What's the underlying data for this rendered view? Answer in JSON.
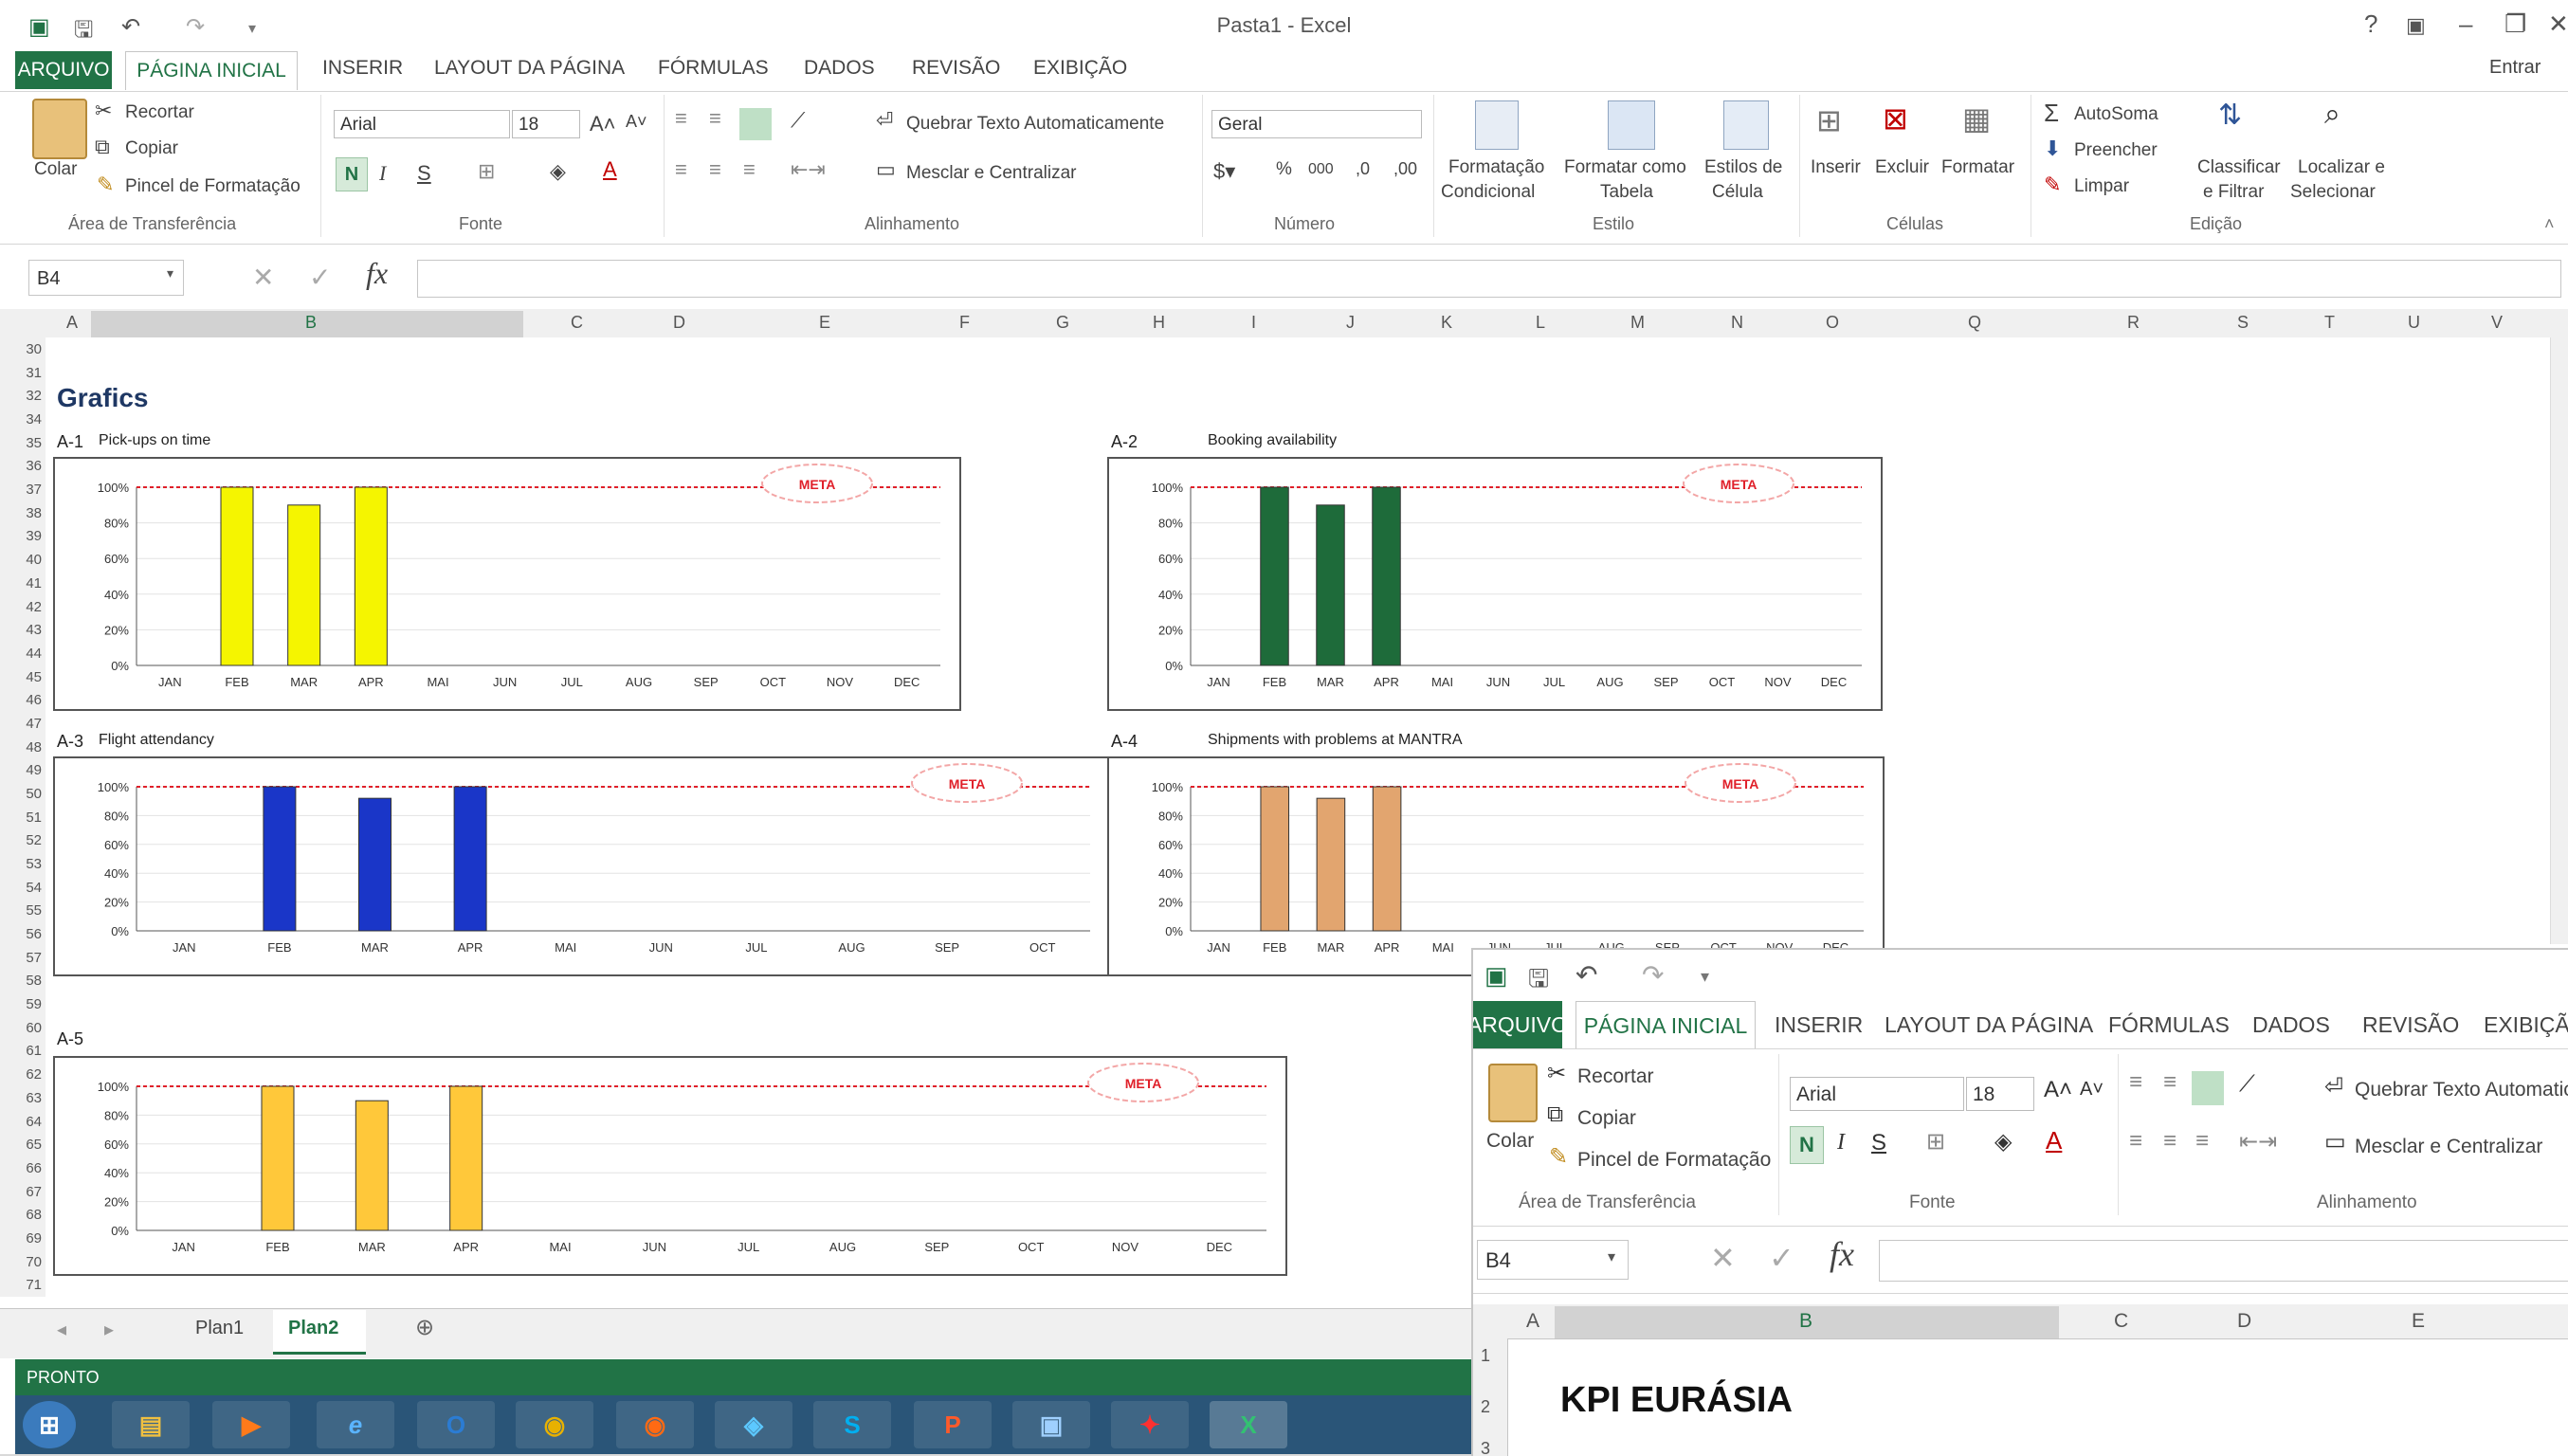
{
  "window": {
    "title": "Pasta1 - Excel",
    "qat_icons": [
      "excel-logo-icon",
      "save-icon",
      "undo-icon",
      "redo-icon",
      "customize-icon"
    ],
    "controls": [
      "?",
      "▣",
      "–",
      "❐",
      "✕"
    ],
    "sign_in": "Entrar"
  },
  "tabs": [
    "ARQUIVO",
    "PÁGINA INICIAL",
    "INSERIR",
    "LAYOUT DA PÁGINA",
    "FÓRMULAS",
    "DADOS",
    "REVISÃO",
    "EXIBIÇÃO"
  ],
  "ribbon": {
    "clipboard": {
      "paste": "Colar",
      "cut": "Recortar",
      "copy": "Copiar",
      "format_painter": "Pincel de Formatação",
      "group": "Área de Transferência"
    },
    "font": {
      "name": "Arial",
      "size": "18",
      "bold": "N",
      "italic": "I",
      "underline": "S",
      "group": "Fonte"
    },
    "alignment": {
      "wrap": "Quebrar Texto Automaticamente",
      "merge": "Mesclar e Centralizar",
      "group": "Alinhamento"
    },
    "number": {
      "format": "Geral",
      "group": "Número"
    },
    "styles": {
      "conditional": "Formatação",
      "conditional2": "Condicional",
      "table": "Formatar como",
      "table2": "Tabela",
      "cell": "Estilos de",
      "cell2": "Célula",
      "group": "Estilo"
    },
    "cells": {
      "insert": "Inserir",
      "delete": "Excluir",
      "format": "Formatar",
      "group": "Células"
    },
    "editing": {
      "autosum": "AutoSoma",
      "fill": "Preencher",
      "clear": "Limpar",
      "sort": "Classificar",
      "sort2": "e Filtrar",
      "find": "Localizar e",
      "find2": "Selecionar",
      "group": "Edição"
    }
  },
  "formula_bar": {
    "name_box": "B4",
    "fx": "fx",
    "content": ""
  },
  "columns": [
    "A",
    "B",
    "C",
    "D",
    "E",
    "F",
    "G",
    "H",
    "I",
    "J",
    "K",
    "L",
    "M",
    "N",
    "O",
    "Q",
    "R",
    "S",
    "T",
    "U",
    "V"
  ],
  "rows": [
    "30",
    "31",
    "32",
    "34",
    "35",
    "36",
    "37",
    "38",
    "39",
    "40",
    "41",
    "42",
    "43",
    "44",
    "45",
    "46",
    "47",
    "48",
    "49",
    "50",
    "51",
    "52",
    "53",
    "54",
    "55",
    "56",
    "57",
    "58",
    "59",
    "60",
    "61",
    "62",
    "63",
    "64",
    "65",
    "66",
    "67",
    "68",
    "69",
    "70",
    "71"
  ],
  "sheet_heading": "Grafics",
  "meta_label": "META",
  "chart_data": [
    {
      "id": "A-1",
      "title": "Pick-ups on time",
      "type": "bar",
      "color": "#f5f500",
      "categories": [
        "JAN",
        "FEB",
        "MAR",
        "APR",
        "MAI",
        "JUN",
        "JUL",
        "AUG",
        "SEP",
        "OCT",
        "NOV",
        "DEC"
      ],
      "values": [
        0,
        100,
        90,
        100,
        0,
        0,
        0,
        0,
        0,
        0,
        0,
        0
      ],
      "yticks": [
        "100%",
        "80%",
        "60%",
        "40%",
        "20%",
        "0%"
      ],
      "ylim": [
        0,
        100
      ],
      "target": 100
    },
    {
      "id": "A-2",
      "title": "Booking availability",
      "type": "bar",
      "color": "#1e6b3a",
      "categories": [
        "JAN",
        "FEB",
        "MAR",
        "APR",
        "MAI",
        "JUN",
        "JUL",
        "AUG",
        "SEP",
        "OCT",
        "NOV",
        "DEC"
      ],
      "values": [
        0,
        100,
        90,
        100,
        0,
        0,
        0,
        0,
        0,
        0,
        0,
        0
      ],
      "yticks": [
        "100%",
        "80%",
        "60%",
        "40%",
        "20%",
        "0%"
      ],
      "ylim": [
        0,
        100
      ],
      "target": 100
    },
    {
      "id": "A-3",
      "title": "Flight attendancy",
      "type": "bar",
      "color": "#1a36c8",
      "categories": [
        "JAN",
        "FEB",
        "MAR",
        "APR",
        "MAI",
        "JUN",
        "JUL",
        "AUG",
        "SEP",
        "OCT"
      ],
      "values": [
        0,
        100,
        92,
        100,
        0,
        0,
        0,
        0,
        0,
        0
      ],
      "yticks": [
        "100%",
        "80%",
        "60%",
        "40%",
        "20%",
        "0%"
      ],
      "ylim": [
        0,
        100
      ],
      "target": 100
    },
    {
      "id": "A-4",
      "title": "Shipments with problems at MANTRA",
      "type": "bar",
      "color": "#e2a56f",
      "categories": [
        "JAN",
        "FEB",
        "MAR",
        "APR",
        "MAI",
        "JUN",
        "JUL",
        "AUG",
        "SEP",
        "OCT",
        "NOV",
        "DEC"
      ],
      "values": [
        0,
        100,
        92,
        100,
        0,
        0,
        0,
        0,
        0,
        0,
        0,
        0
      ],
      "yticks": [
        "100%",
        "80%",
        "60%",
        "40%",
        "20%",
        "0%"
      ],
      "ylim": [
        0,
        100
      ],
      "target": 100
    },
    {
      "id": "A-5",
      "title": "",
      "type": "bar",
      "color": "#ffc83a",
      "categories": [
        "JAN",
        "FEB",
        "MAR",
        "APR",
        "MAI",
        "JUN",
        "JUL",
        "AUG",
        "SEP",
        "OCT",
        "NOV",
        "DEC"
      ],
      "values": [
        0,
        100,
        90,
        100,
        0,
        0,
        0,
        0,
        0,
        0,
        0,
        0
      ],
      "yticks": [
        "100%",
        "80%",
        "60%",
        "40%",
        "20%",
        "0%"
      ],
      "ylim": [
        0,
        100
      ],
      "target": 100
    }
  ],
  "sheet_tabs": [
    "Plan1",
    "Plan2"
  ],
  "status": "PRONTO",
  "taskbar": [
    "start-icon",
    "explorer-icon",
    "media-player-icon",
    "internet-explorer-icon",
    "outlook-icon",
    "chrome-icon",
    "firefox-icon",
    "lync-icon",
    "skype-icon",
    "powerpoint-icon",
    "network-icon",
    "acrobat-icon",
    "excel-icon"
  ],
  "taskbar_glyphs": [
    "⊞",
    "▤",
    "▶",
    "e",
    "O",
    "◉",
    "◉",
    "◈",
    "S",
    "P",
    "▣",
    "✦",
    "X"
  ],
  "window2": {
    "tabs": [
      "ARQUIVO",
      "PÁGINA INICIAL",
      "INSERIR",
      "LAYOUT DA PÁGINA",
      "FÓRMULAS",
      "DADOS",
      "REVISÃO",
      "EXIBIÇÃO"
    ],
    "cut": "Recortar",
    "copy": "Copiar",
    "format_painter": "Pincel de Formatação",
    "paste": "Colar",
    "clipboard_group": "Área de Transferência",
    "font_name": "Arial",
    "font_size": "18",
    "font_group": "Fonte",
    "wrap": "Quebrar Texto Automatic",
    "merge": "Mesclar e Centralizar",
    "align_group": "Alinhamento",
    "name_box": "B4",
    "fx": "fx",
    "columns": [
      "A",
      "B",
      "C",
      "D",
      "E"
    ],
    "rows": [
      "1",
      "2",
      "3"
    ],
    "heading": "KPI EURÁSIA"
  }
}
